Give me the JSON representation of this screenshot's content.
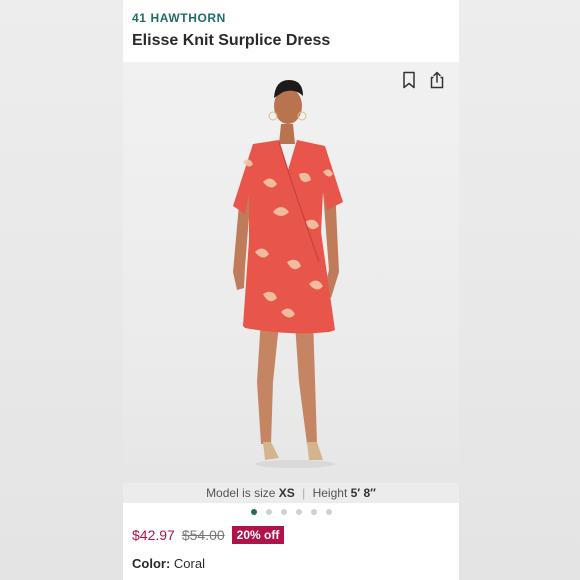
{
  "product": {
    "brand": "41 HAWTHORN",
    "title": "Elisse Knit Surplice Dress"
  },
  "photo": {
    "alt": "Model wearing coral floral wrap dress",
    "actions": [
      "bookmark-icon",
      "share-icon"
    ]
  },
  "model_info": {
    "size_label": "Model is size",
    "size_value": "XS",
    "height_label": "Height",
    "height_value": "5′ 8″"
  },
  "carousel": {
    "count": 6,
    "active_index": 0
  },
  "pricing": {
    "price": "$42.97",
    "original_price": "$54.00",
    "discount_badge": "20% off"
  },
  "color": {
    "label": "Color:",
    "value": "Coral"
  },
  "colors": {
    "brand": "#1f6e63",
    "sale": "#b0124a",
    "dress": "#e8554a"
  }
}
